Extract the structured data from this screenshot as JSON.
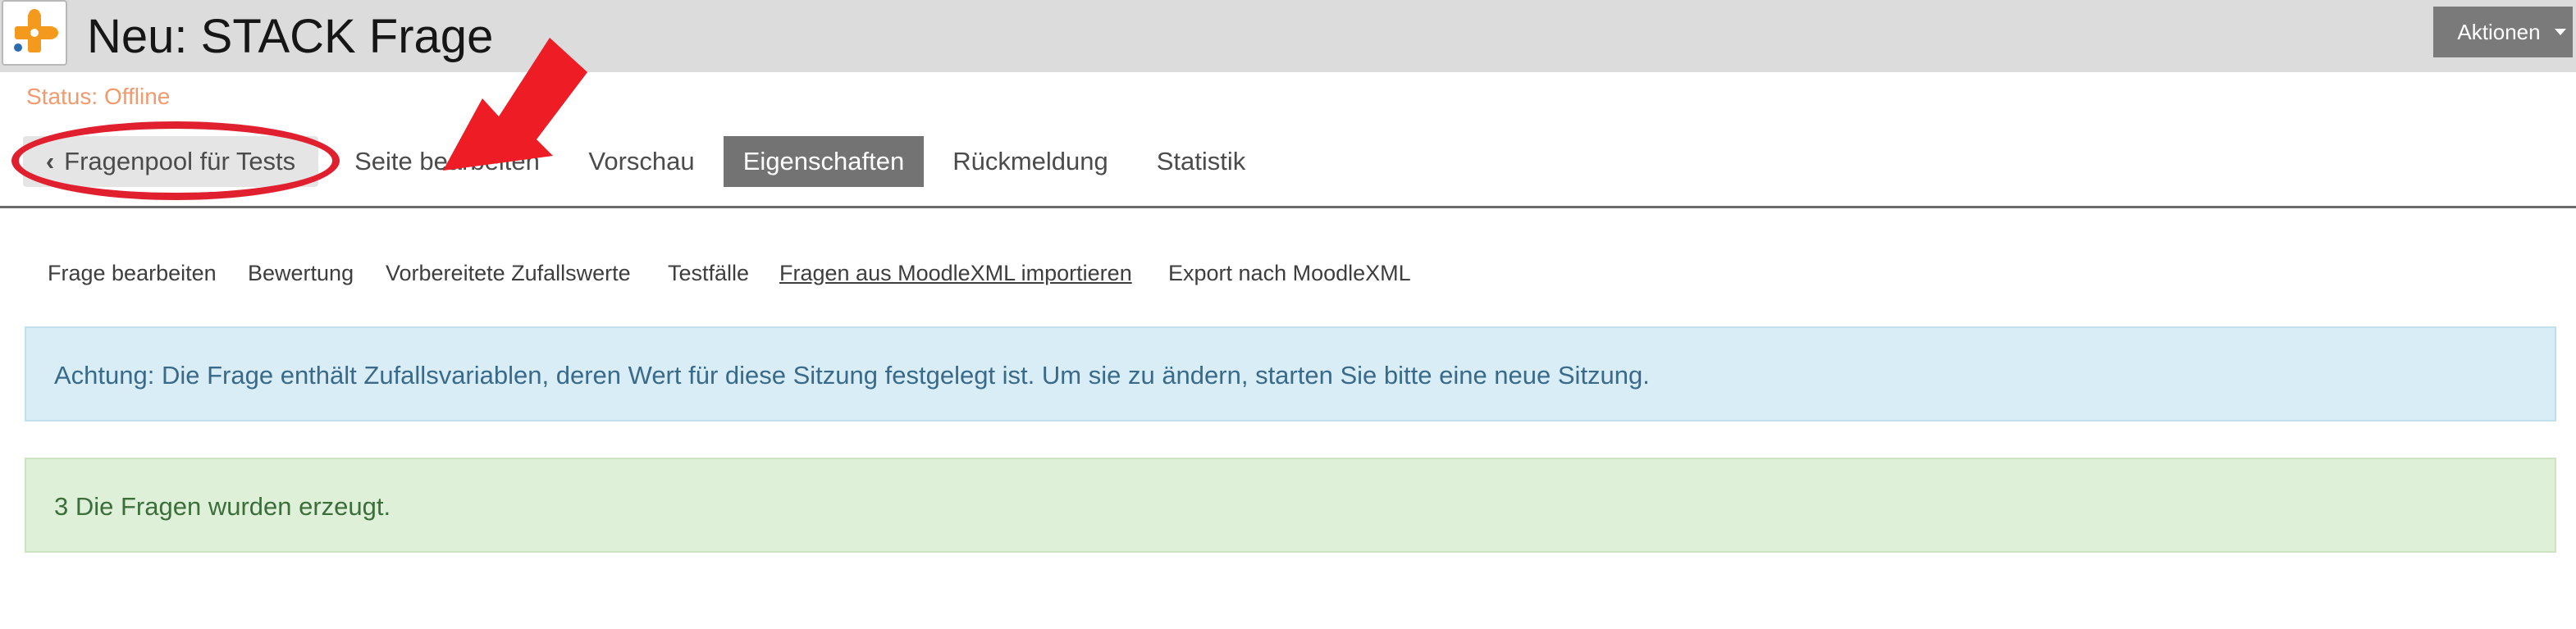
{
  "header": {
    "title": "Neu: STACK Frage",
    "actions_label": "Aktionen",
    "app_icon": "puzzle-icon"
  },
  "status": {
    "text": "Status: Offline"
  },
  "tabs": [
    {
      "label": "Fragenpool für Tests",
      "kind": "back"
    },
    {
      "label": "Seite bearbeiten"
    },
    {
      "label": "Vorschau"
    },
    {
      "label": "Eigenschaften",
      "active": true
    },
    {
      "label": "Rückmeldung"
    },
    {
      "label": "Statistik"
    }
  ],
  "subtabs": [
    {
      "label": "Frage bearbeiten"
    },
    {
      "label": "Bewertung"
    },
    {
      "label": "Vorbereitete Zufallswerte"
    },
    {
      "label": "Testfälle"
    },
    {
      "label": "Fragen aus MoodleXML importieren",
      "active": true
    },
    {
      "label": "Export nach MoodleXML"
    }
  ],
  "messages": {
    "info": "Achtung: Die Frage enthält Zufallsvariablen, deren Wert für diese Sitzung festgelegt ist. Um sie zu ändern, starten Sie bitte eine neue Sitzung.",
    "success": "3 Die Fragen wurden erzeugt."
  },
  "colors": {
    "annotation": "#e0202e",
    "status": "#f09a6e",
    "active_tab": "#737373",
    "info_bg": "#d9edf7",
    "success_bg": "#dff0d8"
  }
}
